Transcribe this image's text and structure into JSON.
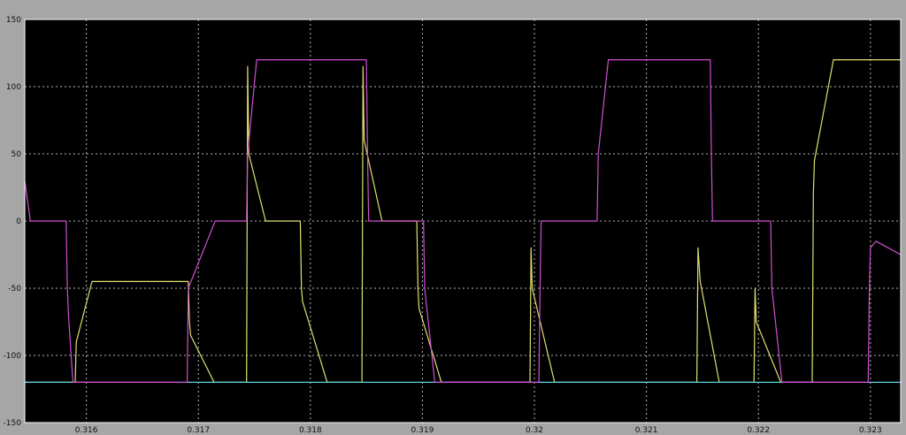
{
  "chart_data": {
    "type": "line",
    "title": "",
    "xlabel": "",
    "ylabel": "",
    "xlim": [
      0.31545,
      0.32327
    ],
    "ylim": [
      -150,
      150
    ],
    "x_ticks": [
      0.316,
      0.317,
      0.318,
      0.319,
      0.32,
      0.321,
      0.322,
      0.323
    ],
    "x_tick_labels": [
      "0.316",
      "0.317",
      "0.318",
      "0.319",
      "0.32",
      "0.321",
      "0.322",
      "0.323"
    ],
    "y_ticks": [
      -150,
      -100,
      -50,
      0,
      50,
      100,
      150
    ],
    "y_tick_labels": [
      "-150",
      "-100",
      "-50",
      "0",
      "50",
      "100",
      "150"
    ],
    "grid": true,
    "legend": "none",
    "colors": {
      "frame": "#a6a6a6",
      "plot_background": "#000000",
      "grid": "#b4b4b4",
      "axis": "#ffffff",
      "tick_label": "#101010"
    },
    "series": [
      {
        "color": "#e0e070",
        "x": [
          0.31545,
          0.31546,
          0.31548,
          0.31564,
          0.31565,
          0.31568,
          0.31587,
          0.31588,
          0.3159,
          0.31591,
          0.31605,
          0.31691,
          0.31692,
          0.31693,
          0.31714,
          0.31715,
          0.31743,
          0.31744,
          0.31745,
          0.3176,
          0.31761,
          0.31791,
          0.31792,
          0.31793,
          0.31815,
          0.31816,
          0.31846,
          0.31847,
          0.31848,
          0.31864,
          0.31865,
          0.31895,
          0.31896,
          0.31897,
          0.31917,
          0.31918,
          0.31996,
          0.31997,
          0.31998,
          0.32018,
          0.32019,
          0.32145,
          0.32146,
          0.32148,
          0.32165,
          0.32166,
          0.32196,
          0.32197,
          0.32198,
          0.3222,
          0.32221,
          0.32248,
          0.32249,
          0.3225,
          0.32267,
          0.32268,
          0.32327
        ],
        "y": [
          -120,
          -120,
          -120,
          -120,
          -120,
          -120,
          -120,
          -120,
          -120,
          -90,
          -45,
          -45,
          -75,
          -85,
          -120,
          -120,
          -120,
          115,
          50,
          0,
          0,
          0,
          -50,
          -60,
          -120,
          -120,
          -120,
          115,
          60,
          0,
          0,
          0,
          -50,
          -65,
          -120,
          -120,
          -120,
          -20,
          -50,
          -120,
          -120,
          -120,
          -20,
          -45,
          -120,
          -120,
          -120,
          -50,
          -75,
          -120,
          -120,
          -120,
          20,
          45,
          120,
          120,
          120
        ]
      },
      {
        "color": "#60d0e0",
        "x": [
          0.31545,
          0.31546,
          0.31548,
          0.31564,
          0.31565,
          0.31636,
          0.31637,
          0.31638,
          0.31656,
          0.31657,
          0.31691,
          0.31692,
          0.31693,
          0.31714,
          0.31715,
          0.31795,
          0.31796,
          0.31797,
          0.31815,
          0.31816,
          0.31847,
          0.31848,
          0.31849,
          0.31865,
          0.31866,
          0.31948,
          0.31949,
          0.3195,
          0.3197,
          0.31971,
          0.32002,
          0.32003,
          0.32004,
          0.32023,
          0.32024,
          0.32102,
          0.32103,
          0.32104,
          0.32122,
          0.32123,
          0.32156,
          0.32157,
          0.32158,
          0.32177,
          0.32178,
          0.32255,
          0.32256,
          0.32257,
          0.32275,
          0.32276,
          0.32308,
          0.32309,
          0.3231,
          0.32326,
          0.32327
        ],
        "y": [
          -120,
          -120,
          -120,
          -120,
          -120,
          -120,
          -120,
          -120,
          -120,
          -120,
          -120,
          -120,
          -120,
          -120,
          -120,
          -120,
          -120,
          -120,
          -120,
          -120,
          -120,
          -120,
          -120,
          -120,
          -120,
          -120,
          -120,
          -120,
          -120,
          -120,
          -120,
          -120,
          -120,
          -120,
          -120,
          -120,
          -120,
          -120,
          -120,
          -120,
          -120,
          -120,
          -120,
          -120,
          -120,
          -120,
          -120,
          -120,
          -120,
          -120,
          -120,
          -120,
          -120,
          -120,
          -120
        ]
      },
      {
        "color": "#d050d0",
        "x": [
          0.31545,
          0.3155,
          0.3156,
          0.31582,
          0.31583,
          0.31584,
          0.31588,
          0.3161,
          0.3169,
          0.31691,
          0.31715,
          0.31743,
          0.31744,
          0.31752,
          0.31774,
          0.3185,
          0.31851,
          0.31852,
          0.31856,
          0.31877,
          0.31901,
          0.31902,
          0.31911,
          0.31933,
          0.32004,
          0.32005,
          0.32006,
          0.32013,
          0.32033,
          0.32056,
          0.32057,
          0.32066,
          0.32088,
          0.32157,
          0.32158,
          0.32159,
          0.32164,
          0.32186,
          0.32211,
          0.32212,
          0.32221,
          0.32242,
          0.32298,
          0.32299,
          0.323,
          0.32305,
          0.32327
        ],
        "y": [
          30,
          0,
          0,
          0,
          -50,
          -70,
          -120,
          -120,
          -120,
          -50,
          0,
          0,
          50,
          120,
          120,
          120,
          50,
          0,
          0,
          0,
          0,
          -50,
          -120,
          -120,
          -120,
          -50,
          0,
          0,
          0,
          0,
          50,
          120,
          120,
          120,
          50,
          0,
          0,
          0,
          0,
          -50,
          -120,
          -120,
          -120,
          -50,
          -20,
          -15,
          -25
        ]
      }
    ]
  }
}
